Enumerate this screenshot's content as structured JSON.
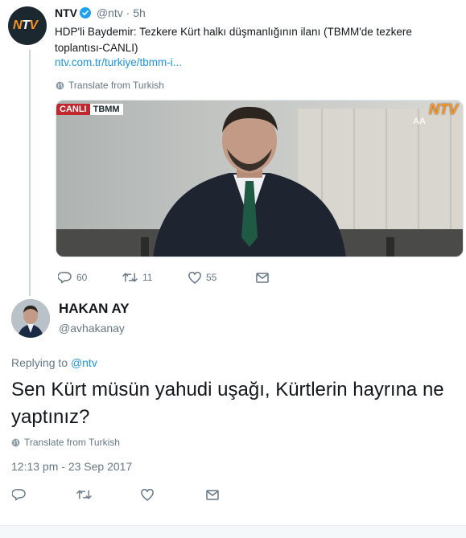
{
  "original_tweet": {
    "name": "NTV",
    "handle": "@ntv",
    "separator": "·",
    "time": "5h",
    "text": "HDP'li Baydemir: Tezkere Kürt halkı düşmanlığının ilanı (TBMM'de tezkere toplantısı-CANLI)",
    "link": "ntv.com.tr/turkiye/tbmm-i...",
    "translate_label": "Translate from Turkish",
    "media": {
      "live_badge": "CANLI",
      "channel_badge": "TBMM",
      "logo": "NTV",
      "agency_logo": "AA"
    },
    "actions": {
      "replies": "60",
      "retweets": "11",
      "likes": "55"
    },
    "icons": [
      "verified-icon",
      "globe-icon",
      "reply-icon",
      "retweet-icon",
      "like-icon",
      "message-icon"
    ]
  },
  "reply_tweet": {
    "name": "HAKAN AY",
    "handle": "@avhakanay",
    "replying_prefix": "Replying to",
    "replying_handle": "@ntv",
    "text": "Sen Kürt müsün yahudi uşağı, Kürtlerin hayrına ne yaptınız?",
    "translate_label": "Translate from Turkish",
    "date": "12:13 pm - 23 Sep 2017",
    "icons": [
      "globe-icon",
      "reply-icon",
      "retweet-icon",
      "like-icon",
      "message-icon"
    ]
  },
  "colors": {
    "link_blue": "#1b95e0",
    "verified_blue": "#1da1f2",
    "muted_gray": "#657786",
    "text_dark": "#14171a",
    "ntv_orange": "#f7931e",
    "live_red": "#c1272d"
  }
}
